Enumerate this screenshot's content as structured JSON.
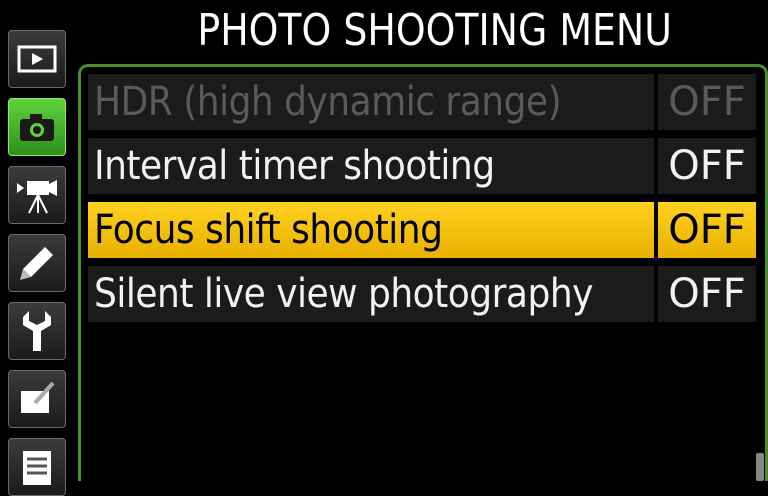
{
  "header": {
    "title": "PHOTO SHOOTING MENU"
  },
  "sidebar": {
    "tabs": [
      {
        "name": "playback-tab",
        "icon": "playback-icon"
      },
      {
        "name": "photo-shooting-tab",
        "icon": "camera-icon",
        "active": true
      },
      {
        "name": "movie-shooting-tab",
        "icon": "movie-camera-icon"
      },
      {
        "name": "custom-settings-tab",
        "icon": "pencil-icon"
      },
      {
        "name": "setup-tab",
        "icon": "wrench-icon"
      },
      {
        "name": "retouch-tab",
        "icon": "retouch-icon"
      },
      {
        "name": "my-menu-tab",
        "icon": "my-menu-icon"
      }
    ]
  },
  "menu": {
    "items": [
      {
        "label": "HDR (high dynamic range)",
        "value": "OFF",
        "state": "disabled"
      },
      {
        "label": "Interval timer shooting",
        "value": "OFF",
        "state": "normal"
      },
      {
        "label": "Focus shift shooting",
        "value": "OFF",
        "state": "selected"
      },
      {
        "label": "Silent live view photography",
        "value": "OFF",
        "state": "normal"
      }
    ]
  },
  "colors": {
    "highlight": "#f5c000",
    "accent": "#4a8e2a",
    "active_tab": "#4fc22e"
  }
}
